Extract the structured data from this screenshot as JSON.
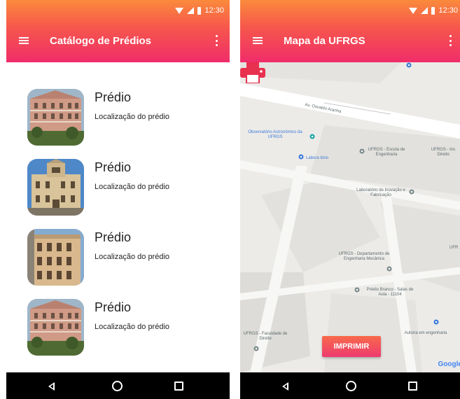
{
  "status_bar": {
    "time": "12:30"
  },
  "catalog": {
    "title": "Catálogo de Prédios",
    "items": [
      {
        "name": "Prédio",
        "location": "Localização do prédio"
      },
      {
        "name": "Prédio",
        "location": "Localização do prédio"
      },
      {
        "name": "Prédio",
        "location": "Localização do prédio"
      },
      {
        "name": "Prédio",
        "location": "Localização do prédio"
      }
    ]
  },
  "map_screen": {
    "title": "Mapa da UFRGS",
    "street": "Av. Osvaldo Aranha",
    "places": {
      "observatorio": "Observatório Astronômico da UFRGS",
      "place_small": "Labora tório",
      "escola": "UFRGS - Escola de Engenharia",
      "ufrgs_right": "UFRGS - Ins Direito",
      "laboratorio": "Laboratório de Inovação e Fabricação",
      "departamento": "UFRGS - Departamento de Engenharia Mecânica",
      "predio": "Prédio Branco - Salas de Aula - 11104",
      "faculdade": "UFRGS - Faculdade de Direito",
      "autoria": "Autoria em engenharia",
      "edge_right": "UFR"
    },
    "print_label": "IMPRIMIR",
    "google": "Google"
  },
  "colors": {
    "appbar_top": "#fb8a3c",
    "appbar_bottom": "#f02d6a",
    "navbar": "#000000",
    "map_bg": "#ecebe8",
    "pin": "#3d7bd9",
    "print_icon": "#e8304f"
  },
  "icons": {
    "menu": "menu-icon",
    "overflow": "more-vert-icon",
    "back": "nav-back-icon",
    "home": "nav-home-icon",
    "recent": "nav-recent-icon",
    "print": "printer-icon",
    "pin": "map-pin-icon"
  }
}
